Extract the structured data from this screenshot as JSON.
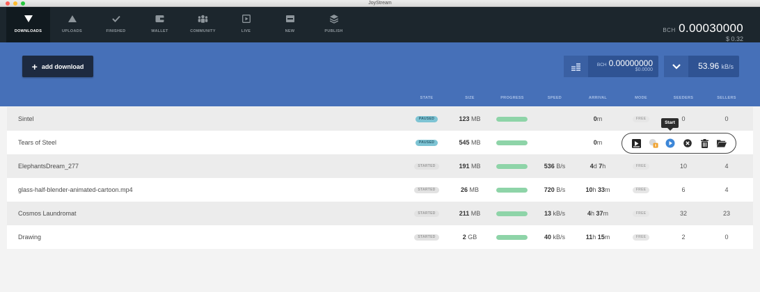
{
  "window": {
    "title": "JoyStream"
  },
  "nav": {
    "items": [
      {
        "label": "DOWNLOADS",
        "icon": "triangle-down-icon"
      },
      {
        "label": "UPLOADS",
        "icon": "triangle-up-icon"
      },
      {
        "label": "FINISHED",
        "icon": "checkmark-icon"
      },
      {
        "label": "WALLET",
        "icon": "wallet-icon"
      },
      {
        "label": "COMMUNITY",
        "icon": "community-icon"
      },
      {
        "label": "LIVE",
        "icon": "play-box-icon"
      },
      {
        "label": "NEW",
        "icon": "new-icon"
      },
      {
        "label": "PUBLISH",
        "icon": "layers-icon"
      }
    ],
    "active": "DOWNLOADS"
  },
  "balance": {
    "currency": "BCH",
    "amount": "0.00030000",
    "usd": "$ 0.32"
  },
  "toolbar": {
    "add_label": "add download",
    "wallet_currency": "BCH",
    "wallet_amount": "0.00000000",
    "wallet_usd": "$0.0000",
    "speed_value": "53.96",
    "speed_unit": "kB/s"
  },
  "columns": [
    "STATE",
    "SIZE",
    "PROGRESS",
    "SPEED",
    "ARRIVAL",
    "MODE",
    "SEEDERS",
    "SELLERS"
  ],
  "rows": [
    {
      "name": "Sintel",
      "state": "PAUSED",
      "size_num": "123",
      "size_unit": " MB",
      "progress": 1.0,
      "speed_num": "",
      "speed_unit": "",
      "arr_a": "0",
      "arr_au": "m",
      "arr_b": "",
      "arr_bu": "",
      "mode": "FREE",
      "seeders": "0",
      "sellers": "0"
    },
    {
      "name": "Tears of Steel",
      "state": "PAUSED",
      "size_num": "545",
      "size_unit": " MB",
      "progress": 1.0,
      "speed_num": "",
      "speed_unit": "",
      "arr_a": "0",
      "arr_au": "m",
      "arr_b": "",
      "arr_bu": "",
      "mode": "",
      "seeders": "",
      "sellers": ""
    },
    {
      "name": "ElephantsDream_277",
      "state": "STARTED",
      "size_num": "191",
      "size_unit": " MB",
      "progress": 1.0,
      "speed_num": "536",
      "speed_unit": " B/s",
      "arr_a": "4",
      "arr_au": "d ",
      "arr_b": "7",
      "arr_bu": "h",
      "mode": "FREE",
      "seeders": "10",
      "sellers": "4"
    },
    {
      "name": "glass-half-blender-animated-cartoon.mp4",
      "state": "STARTED",
      "size_num": "26",
      "size_unit": " MB",
      "progress": 1.0,
      "speed_num": "720",
      "speed_unit": " B/s",
      "arr_a": "10",
      "arr_au": "h ",
      "arr_b": "33",
      "arr_bu": "m",
      "mode": "FREE",
      "seeders": "6",
      "sellers": "4"
    },
    {
      "name": "Cosmos Laundromat",
      "state": "STARTED",
      "size_num": "211",
      "size_unit": " MB",
      "progress": 1.0,
      "speed_num": "13",
      "speed_unit": " kB/s",
      "arr_a": "4",
      "arr_au": "h ",
      "arr_b": "37",
      "arr_bu": "m",
      "mode": "FREE",
      "seeders": "32",
      "sellers": "23"
    },
    {
      "name": "Drawing",
      "state": "STARTED",
      "size_num": "2",
      "size_unit": " GB",
      "progress": 1.0,
      "speed_num": "40",
      "speed_unit": " kB/s",
      "arr_a": "11",
      "arr_au": "h ",
      "arr_b": "15",
      "arr_bu": "m",
      "mode": "FREE",
      "seeders": "2",
      "sellers": "0"
    }
  ],
  "row_actions": {
    "tooltip": "Start",
    "icons": [
      "play-stream-icon",
      "coin-lock-icon",
      "play-circle-icon",
      "remove-circle-icon",
      "trash-icon",
      "folder-open-icon"
    ]
  },
  "colors": {
    "nav_bg": "#1c262d",
    "band_bg": "#4670b8",
    "progress": "#8ed4a8",
    "paused_badge": "#7ec4d4"
  }
}
